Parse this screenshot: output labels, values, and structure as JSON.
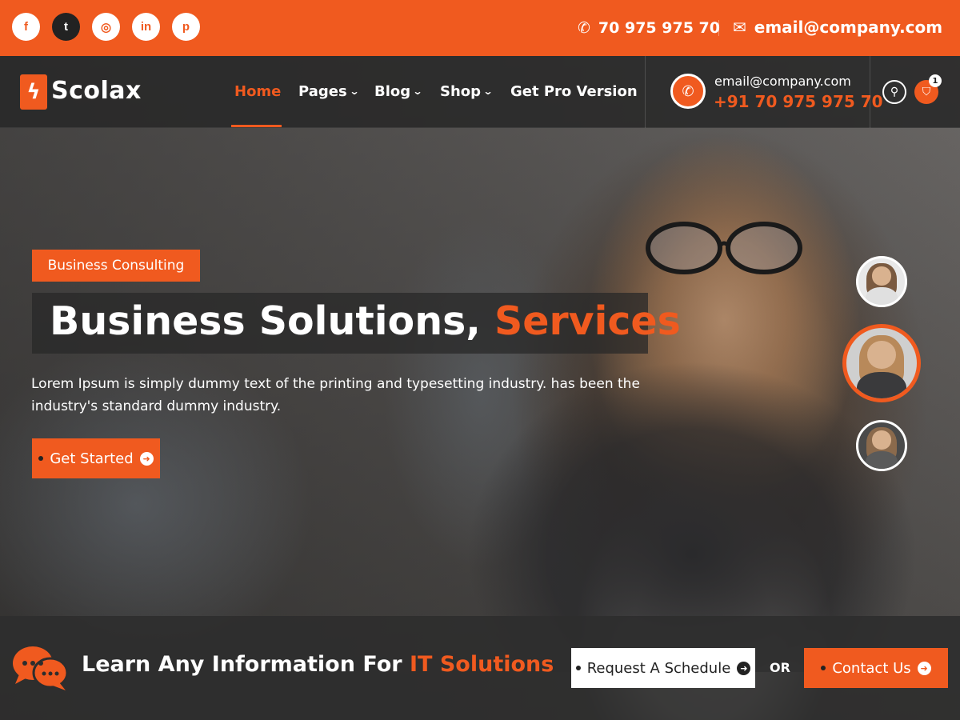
{
  "brand_color": "#f05a1f",
  "topbar": {
    "social": [
      {
        "icon": "facebook-icon",
        "glyph": "f"
      },
      {
        "icon": "twitter-icon",
        "glyph": "t"
      },
      {
        "icon": "instagram-icon",
        "glyph": "◎"
      },
      {
        "icon": "linkedin-icon",
        "glyph": "in"
      },
      {
        "icon": "pinterest-icon",
        "glyph": "p"
      }
    ],
    "phone": "70 975 975 70",
    "email": "email@company.com"
  },
  "nav": {
    "logo": "Scolax",
    "items": [
      {
        "label": "Home",
        "active": true
      },
      {
        "label": "Pages",
        "dropdown": true
      },
      {
        "label": "Blog",
        "dropdown": true
      },
      {
        "label": "Shop",
        "dropdown": true
      },
      {
        "label": "Get Pro Version"
      }
    ],
    "contact_email": "email@company.com",
    "contact_phone": "+91 70 975 975 70",
    "cart_count": "1"
  },
  "hero": {
    "tagline": "Business Consulting",
    "headline_main": "Business Solutions, ",
    "headline_accent": "Services",
    "lead": "Lorem Ipsum is simply dummy text of the printing and typesetting industry. has been the industry's standard dummy industry.",
    "cta": "Get Started"
  },
  "bottom": {
    "text_main": "Learn Any Information For ",
    "text_accent": "IT Solutions",
    "schedule_button": "Request A Schedule",
    "or": "OR",
    "contact_button": "Contact Us"
  }
}
